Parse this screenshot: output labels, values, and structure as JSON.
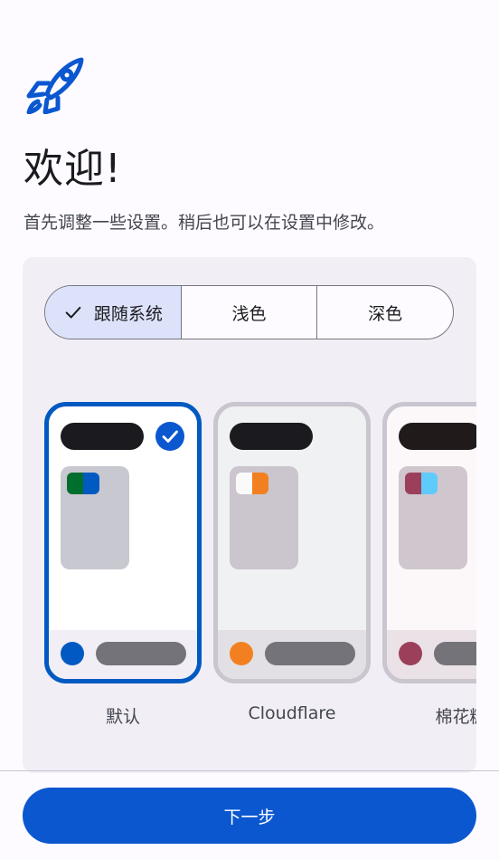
{
  "header": {
    "icon": "rocket-icon",
    "title": "欢迎!",
    "subtitle": "首先调整一些设置。稍后也可以在设置中修改。"
  },
  "mode_selector": {
    "options": [
      {
        "label": "跟随系统",
        "selected": true
      },
      {
        "label": "浅色",
        "selected": false
      },
      {
        "label": "深色",
        "selected": false
      }
    ]
  },
  "themes": [
    {
      "name": "默认",
      "selected": true,
      "colors": {
        "bg": "#ffffff",
        "bar": "#1b1b1f",
        "card": "#c8c8d0",
        "swatch_a": "#006e2c",
        "swatch_b": "#005ac1",
        "dot": "#005ac1",
        "bottom": "#f1eef6"
      }
    },
    {
      "name": "Cloudflare",
      "selected": false,
      "colors": {
        "bg": "#eff1f2",
        "bar": "#1b1b1f",
        "card": "#cbc5ce",
        "swatch_a": "#fafafa",
        "swatch_b": "#f38020",
        "dot": "#f38020",
        "bottom": "#e2e0e4"
      }
    },
    {
      "name": "棉花糖",
      "selected": false,
      "colors": {
        "bg": "#fcf8fa",
        "bar": "#201a1b",
        "card": "#cfc6ce",
        "swatch_a": "#9c3f5b",
        "swatch_b": "#5ecbfb",
        "dot": "#9c3f5b",
        "bottom": "#eae2e6"
      }
    }
  ],
  "footer": {
    "next_label": "下一步"
  }
}
